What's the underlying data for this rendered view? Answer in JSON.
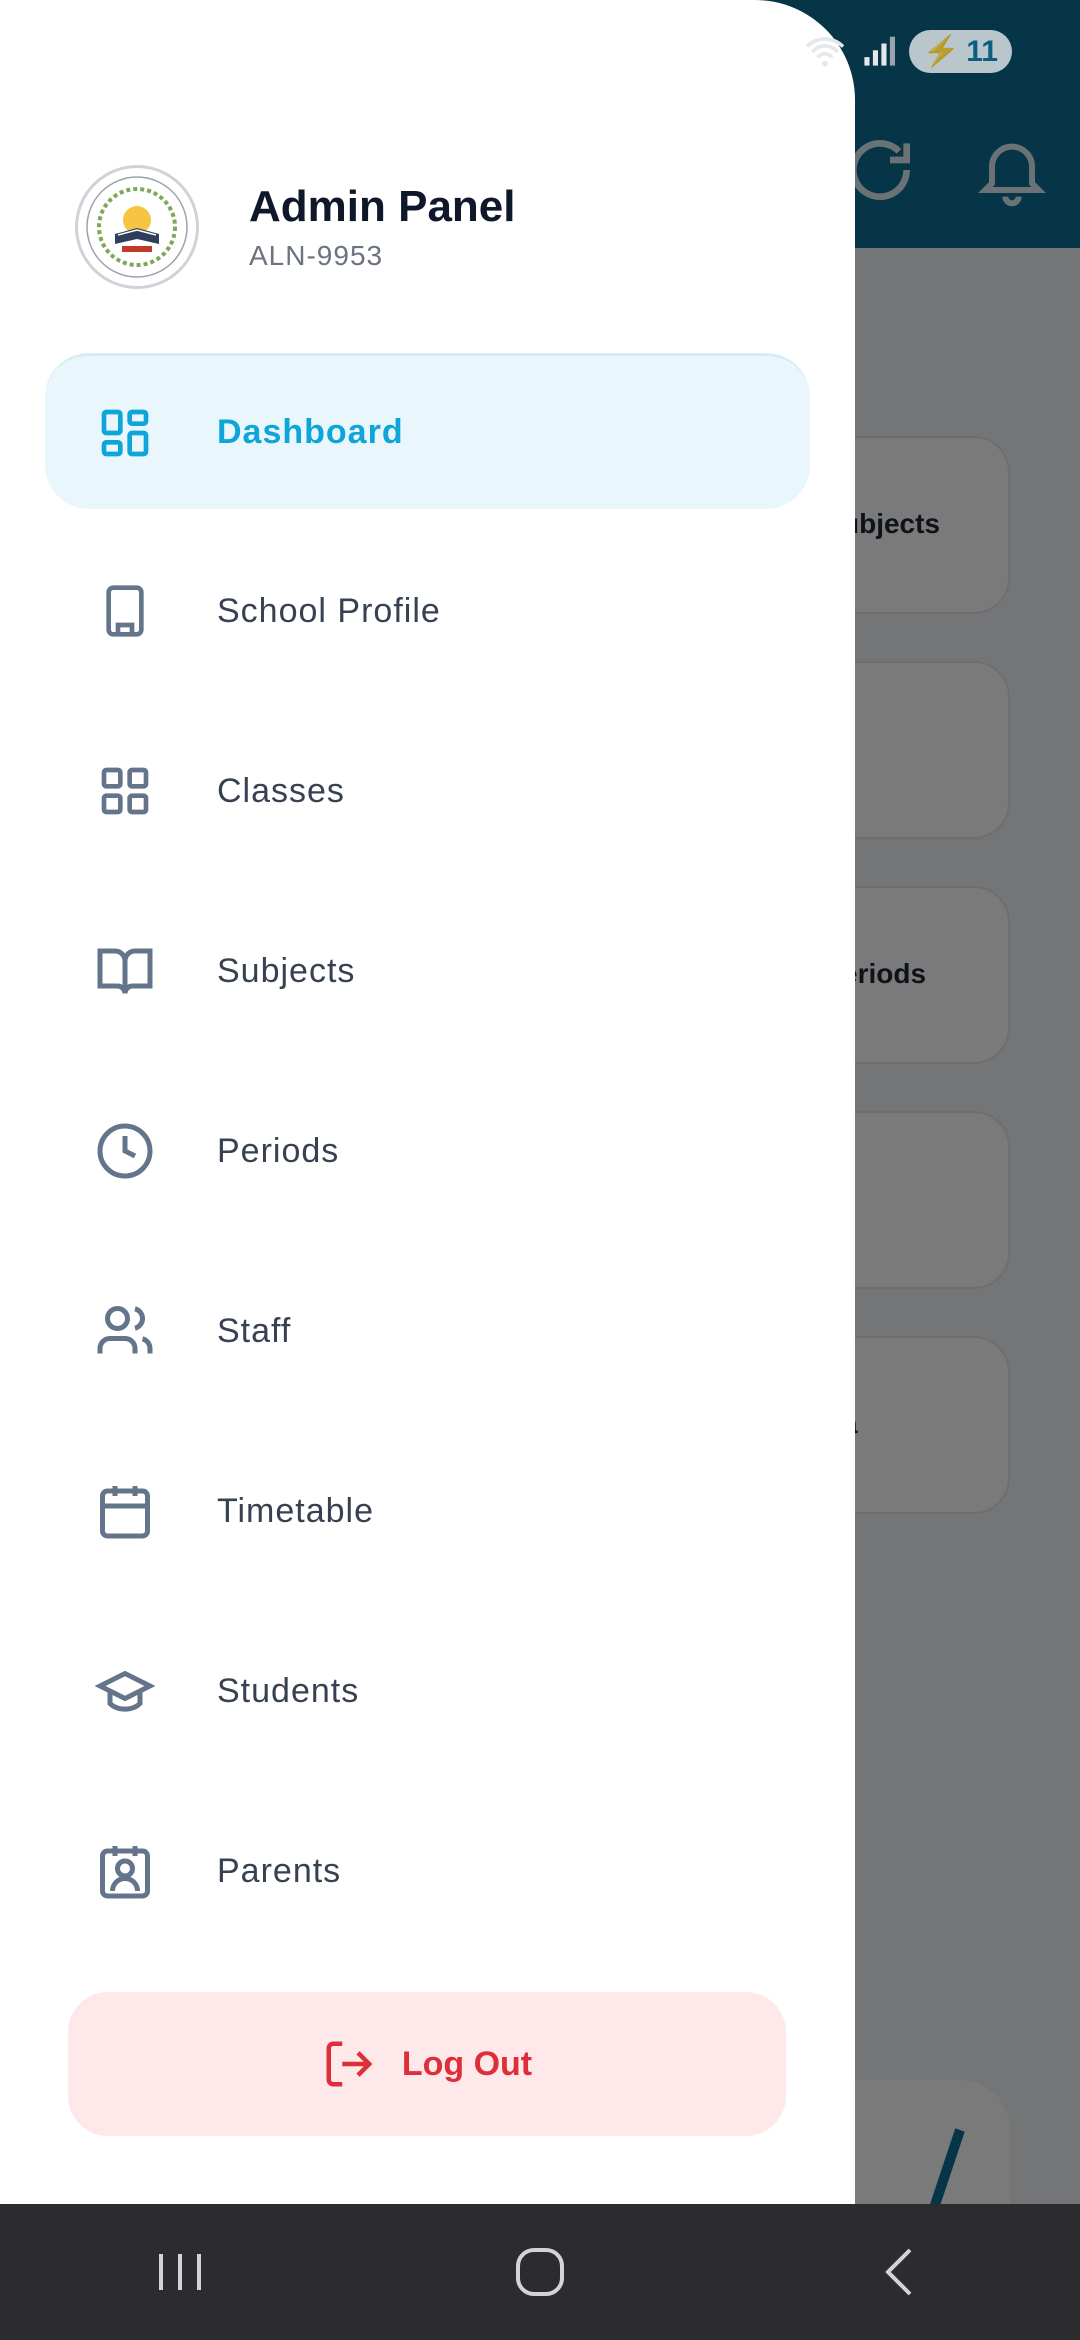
{
  "status_bar": {
    "battery": "11"
  },
  "drawer": {
    "title": "Admin Panel",
    "subtitle": "ALN-9953",
    "menu": [
      {
        "label": "Dashboard",
        "icon": "dashboard-icon",
        "active": true
      },
      {
        "label": "School Profile",
        "icon": "building-icon"
      },
      {
        "label": "Classes",
        "icon": "grid-icon"
      },
      {
        "label": "Subjects",
        "icon": "book-icon"
      },
      {
        "label": "Periods",
        "icon": "clock-icon"
      },
      {
        "label": "Staff",
        "icon": "users-icon"
      },
      {
        "label": "Timetable",
        "icon": "calendar-icon"
      },
      {
        "label": "Students",
        "icon": "graduation-cap-icon"
      },
      {
        "label": "Parents",
        "icon": "contact-badge-icon"
      }
    ],
    "logout_label": "Log Out"
  },
  "background": {
    "cards": [
      "ubjects",
      "",
      "eriods",
      "",
      "a"
    ]
  },
  "colors": {
    "accent": "#0ea5d8",
    "topbar": "#0d6f94",
    "logout": "#dc2f3a"
  }
}
